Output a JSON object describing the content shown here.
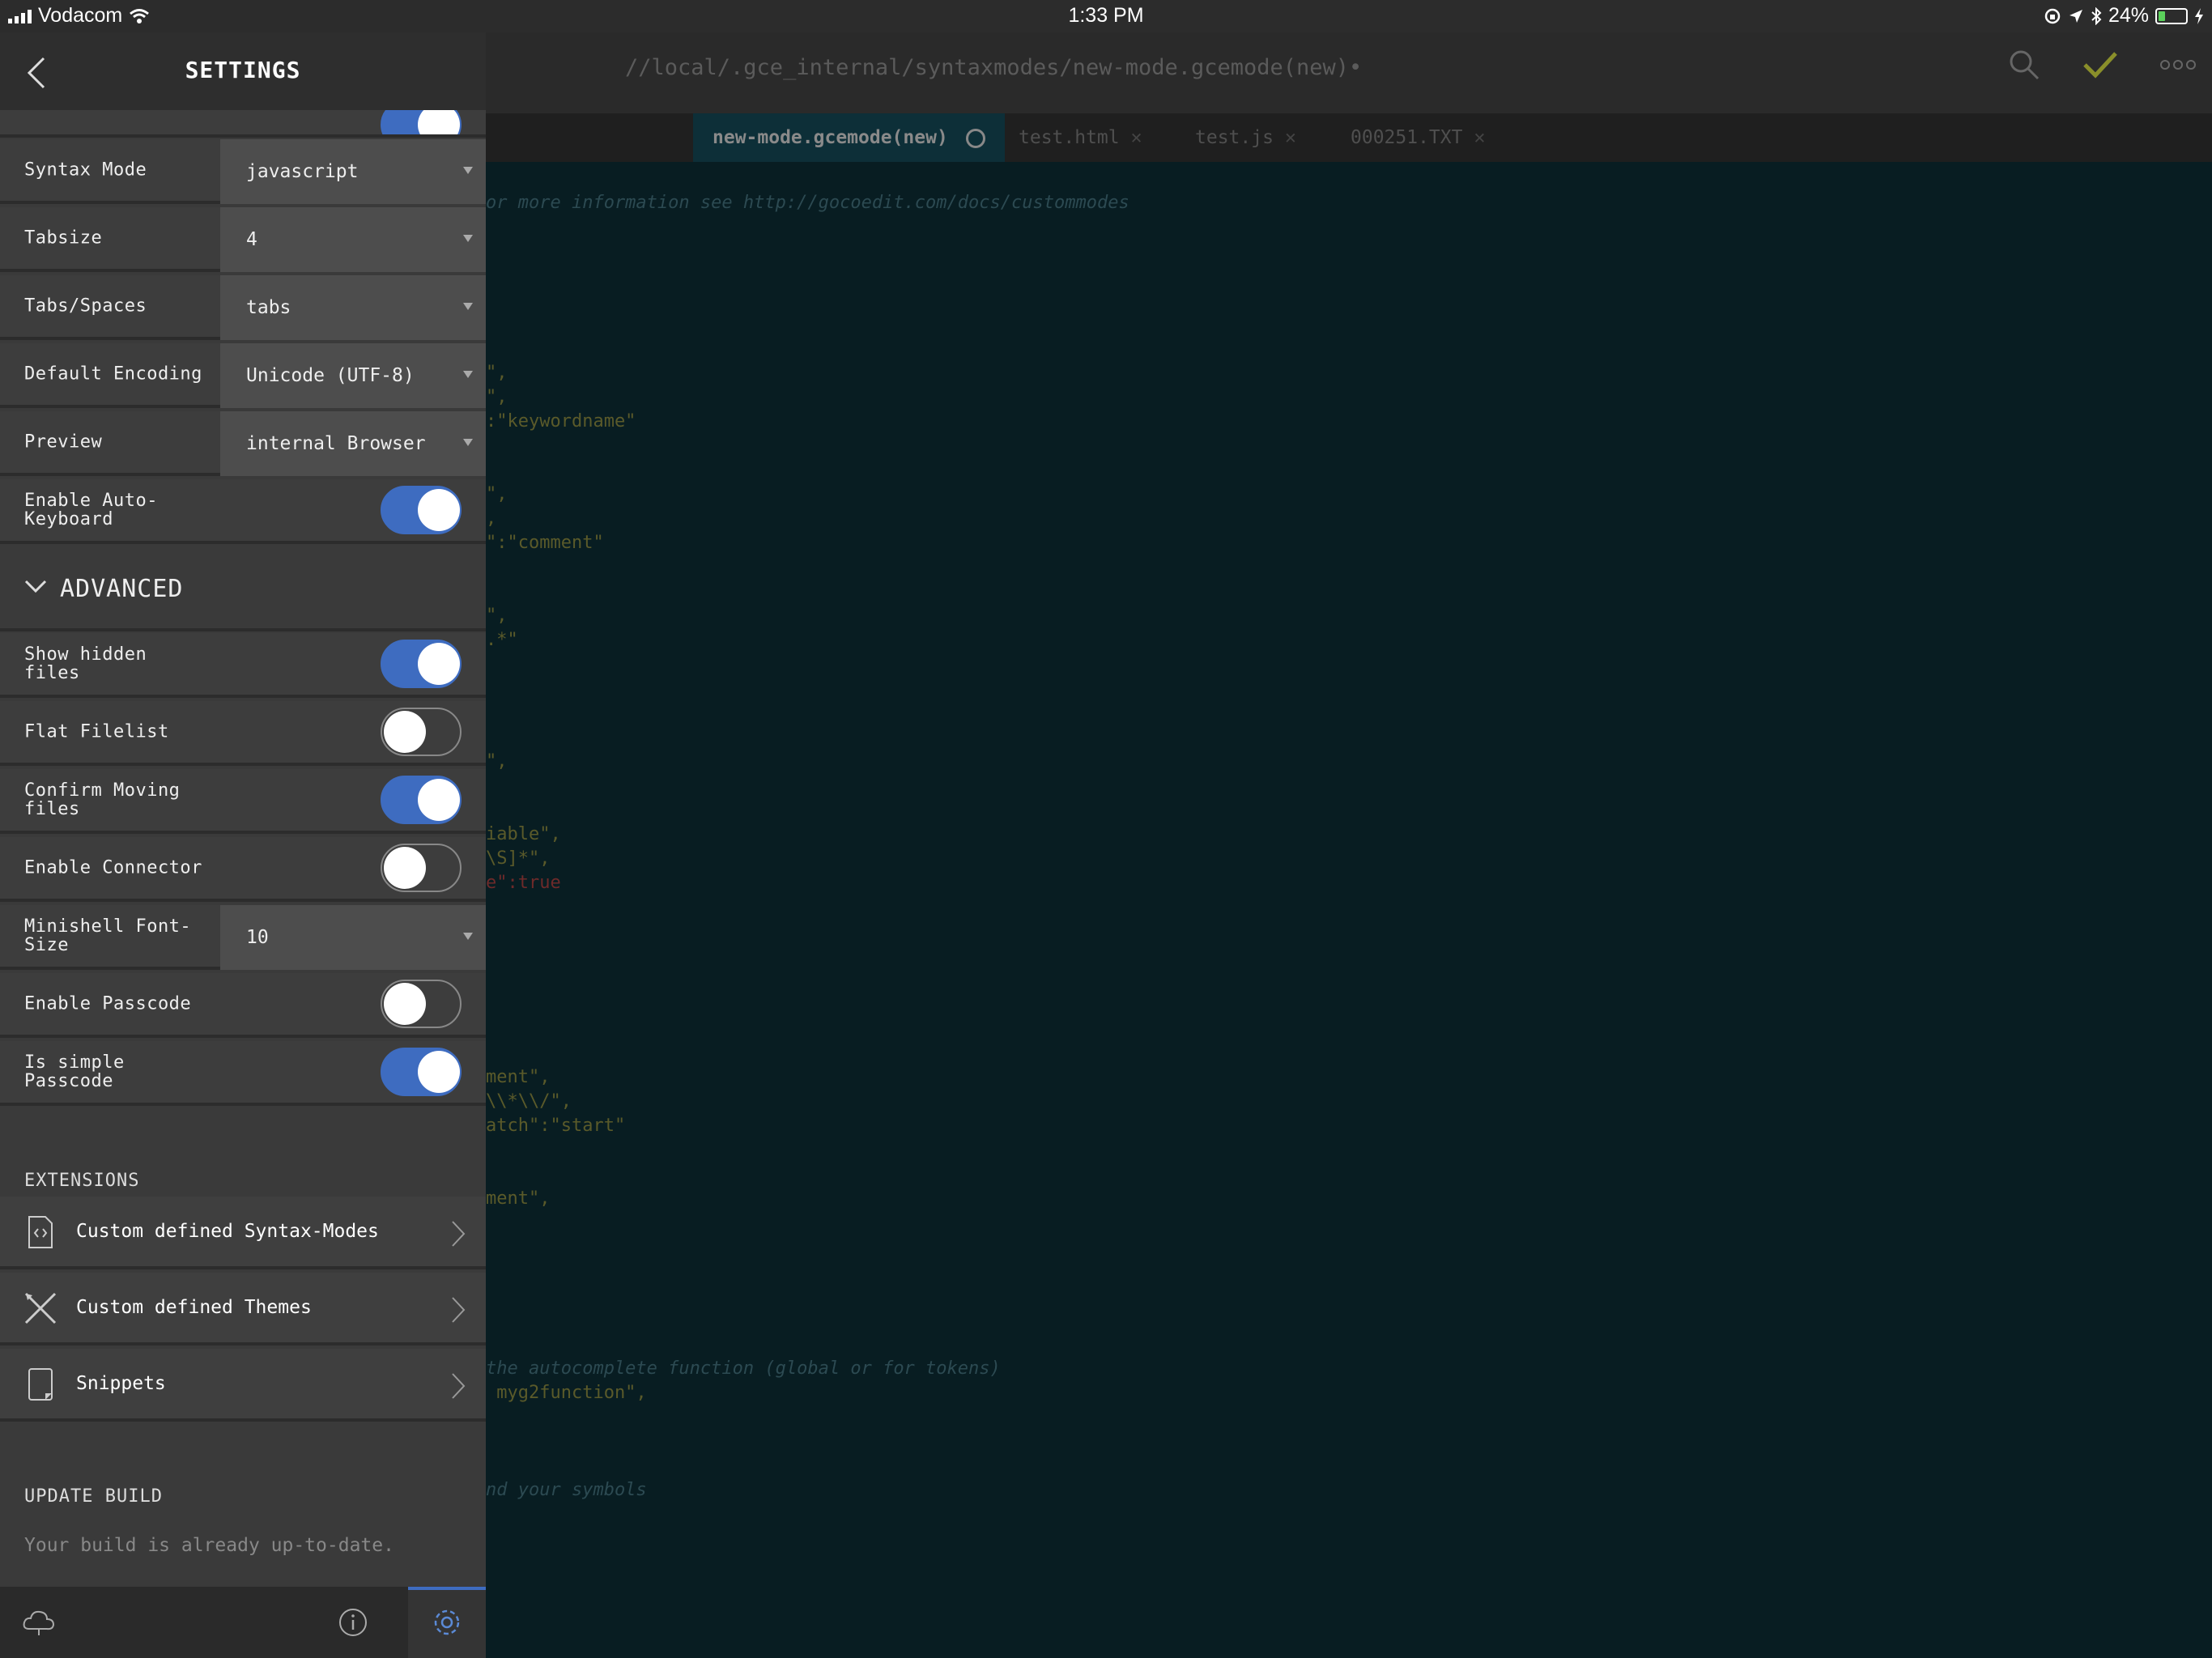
{
  "status_bar": {
    "carrier": "Vodacom",
    "time": "1:33 PM",
    "battery": "24%",
    "battery_level": 0.24
  },
  "editor": {
    "path": "//local/.gce_internal/syntaxmodes/new-mode.gcemode(new)•",
    "tabs": [
      {
        "label": "new-mode.gcemode(new)"
      },
      {
        "label": "test.html"
      },
      {
        "label": "test.js"
      },
      {
        "label": "000251.TXT"
      }
    ],
    "code_lines": [
      "or more information see http://gocoedit.com/docs/custommodes",
      "\",",
      "\",",
      ":\"keywordname\"",
      "\",",
      ",",
      "\":\"comment\"",
      "\",",
      ".*\"",
      "\",",
      "iable\",",
      "\\S]*\",",
      "e\":true",
      "ment\",",
      "\\\\*\\\\/\",",
      "atch\":\"start\"",
      "ment\",",
      "the autocomplete function (global or for tokens)",
      " myg2function\",",
      "nd your symbols"
    ]
  },
  "settings": {
    "title": "SETTINGS",
    "rows": [
      {
        "label": "Syntax Mode",
        "value": "javascript"
      },
      {
        "label": "Tabsize",
        "value": "4"
      },
      {
        "label": "Tabs/Spaces",
        "value": "tabs"
      },
      {
        "label": "Default Encoding",
        "value": "Unicode (UTF-8)"
      },
      {
        "label": "Preview",
        "value": "internal Browser"
      }
    ],
    "auto_keyboard": {
      "label": "Enable Auto-Keyboard",
      "on": true
    },
    "advanced": {
      "title": "ADVANCED",
      "show_hidden": {
        "label": "Show hidden files",
        "on": true
      },
      "flat_filelist": {
        "label": "Flat Filelist",
        "on": false
      },
      "confirm_moving": {
        "label": "Confirm Moving files",
        "on": true
      },
      "enable_connector": {
        "label": "Enable Connector",
        "on": false
      },
      "minishell": {
        "label": "Minishell Font-Size",
        "value": "10"
      },
      "enable_passcode": {
        "label": "Enable Passcode",
        "on": false
      },
      "simple_passcode": {
        "label": "Is simple Passcode",
        "on": true
      }
    },
    "extensions": {
      "title": "EXTENSIONS",
      "items": [
        {
          "label": "Custom defined Syntax-Modes",
          "icon": "code-file-icon"
        },
        {
          "label": "Custom defined Themes",
          "icon": "brush-pencil-icon"
        },
        {
          "label": "Snippets",
          "icon": "snippets-icon"
        }
      ]
    },
    "update": {
      "title": "UPDATE BUILD",
      "status": "Your build is already up-to-date."
    }
  },
  "colors": {
    "accent": "#3e6cc0",
    "panel": "#3a3a3a",
    "editor_bg": "#081d22",
    "check": "#8a8f2a"
  }
}
